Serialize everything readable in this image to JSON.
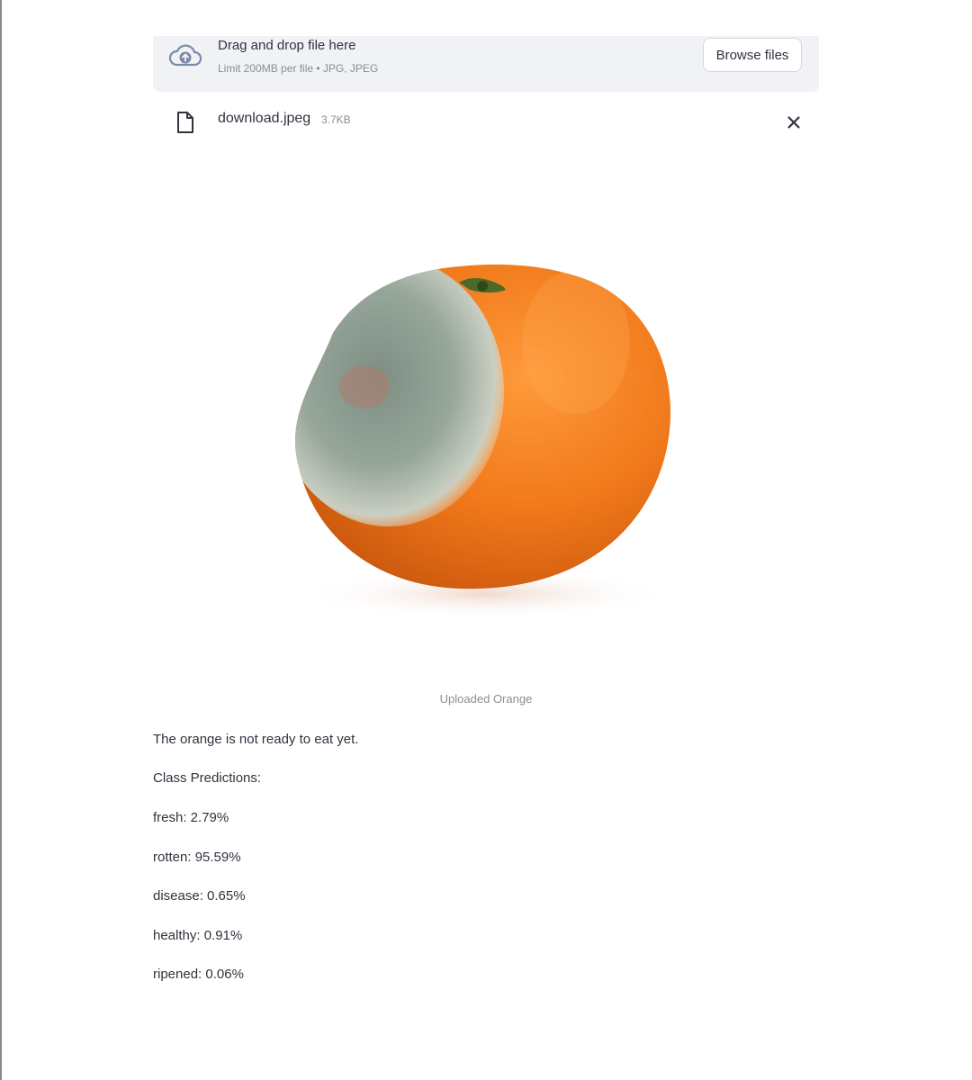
{
  "uploader": {
    "icon": "cloud-upload-icon",
    "title": "Drag and drop file here",
    "limit_text": "Limit 200MB per file • JPG, JPEG",
    "browse_label": "Browse files"
  },
  "uploaded_file": {
    "icon": "file-icon",
    "name": "download.jpeg",
    "size": "3.7KB",
    "remove_icon": "close-icon"
  },
  "image": {
    "caption": "Uploaded Orange"
  },
  "result": {
    "message": "The orange is not ready to eat yet.",
    "predictions_heading": "Class Predictions:",
    "predictions": [
      "fresh: 2.79%",
      "rotten: 95.59%",
      "disease: 0.65%",
      "healthy: 0.91%",
      "ripened: 0.06%"
    ]
  },
  "colors": {
    "dropzone_bg": "#f0f2f6",
    "text": "#31333f",
    "muted_text": "#8b8d97",
    "orange": "#f07a1c",
    "mold": "#8fa094"
  }
}
